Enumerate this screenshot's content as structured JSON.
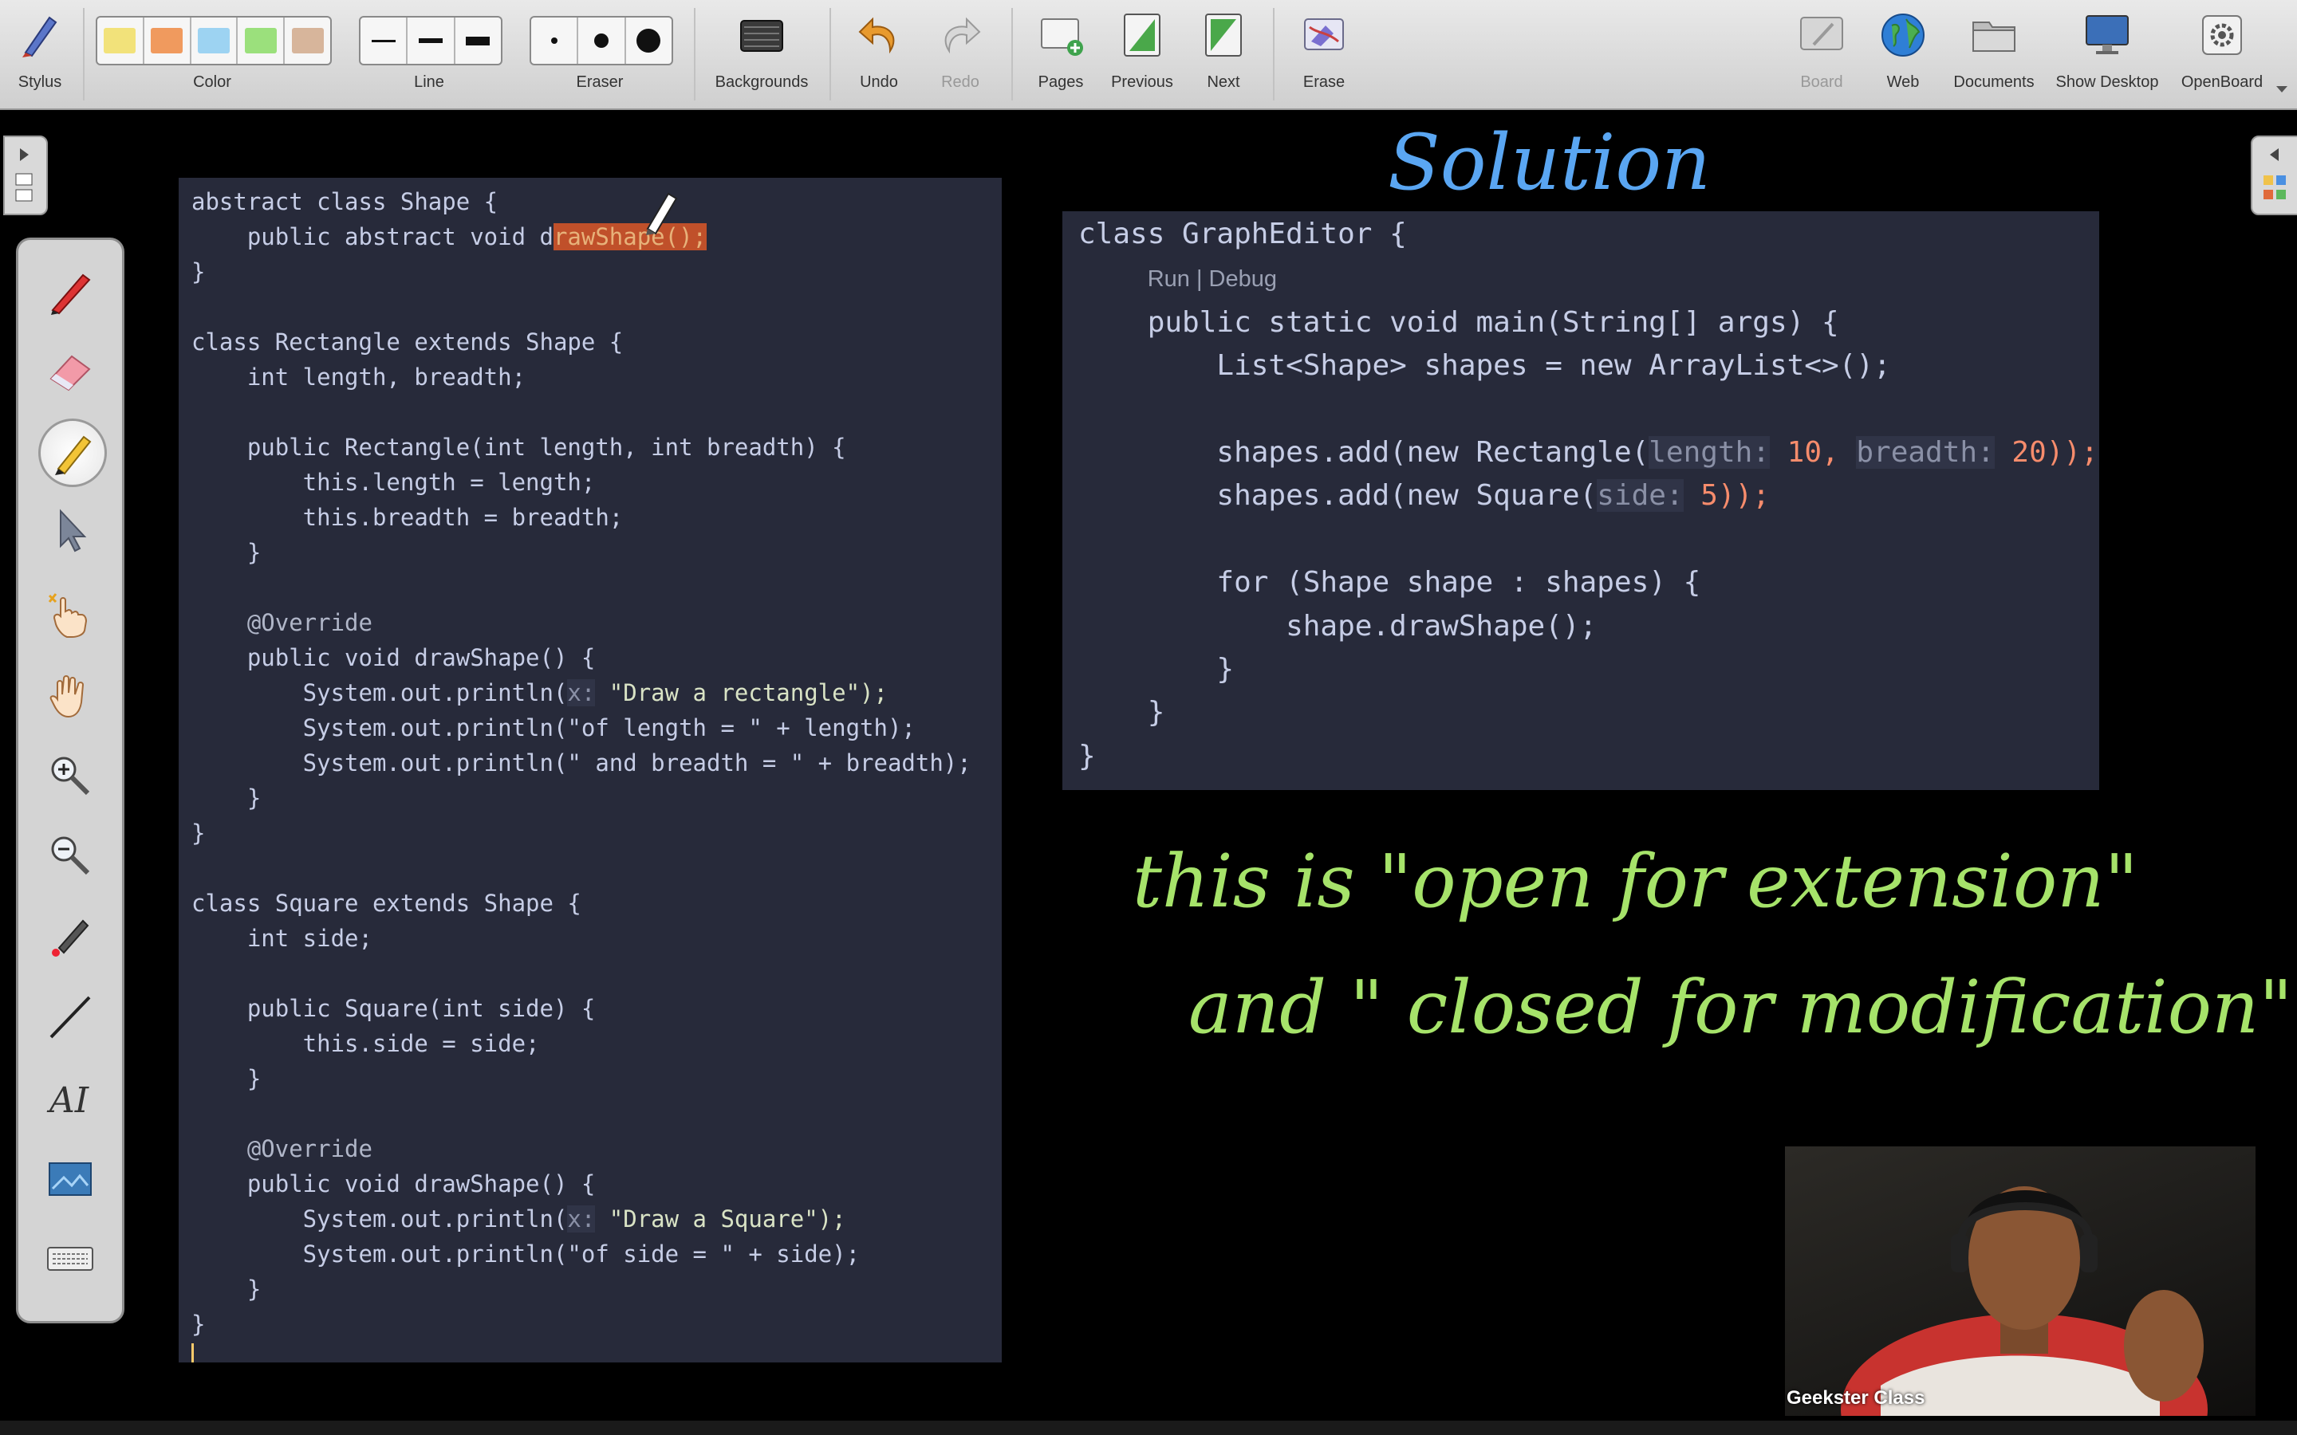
{
  "toolbar": {
    "stylus": "Stylus",
    "color": "Color",
    "line": "Line",
    "eraser": "Eraser",
    "backgrounds": "Backgrounds",
    "undo": "Undo",
    "redo": "Redo",
    "pages": "Pages",
    "previous": "Previous",
    "next": "Next",
    "erase": "Erase",
    "board": "Board",
    "web": "Web",
    "documents": "Documents",
    "show_desktop": "Show Desktop",
    "openboard": "OpenBoard"
  },
  "colors": {
    "swatches": [
      "#f2e27a",
      "#f09a5e",
      "#9dd3f2",
      "#9be07c",
      "#d7b59b"
    ],
    "code_bg": "#272a3a",
    "handwriting_green": "#a6e36a",
    "handwriting_blue": "#5aa6f2",
    "highlight": "#c0502a"
  },
  "handwriting": {
    "title": "Solution",
    "line1": "this is \"open for extension\"",
    "line2": "and \" closed for modification\""
  },
  "code_left": {
    "l01": "abstract class Shape {",
    "l02a": "    public abstract void d",
    "l02b": "rawShape();",
    "l03": "}",
    "l05": "class Rectangle extends Shape {",
    "l06": "    int length, breadth;",
    "l08": "    public Rectangle(int length, int breadth) {",
    "l09": "        this.length = length;",
    "l10": "        this.breadth = breadth;",
    "l11": "    }",
    "l13": "    @Override",
    "l14": "    public void drawShape() {",
    "l15a": "        System.out.println(",
    "l15h": "x:",
    "l15b": " \"Draw a rectangle\");",
    "l16": "        System.out.println(\"of length = \" + length);",
    "l17": "        System.out.println(\" and breadth = \" + breadth);",
    "l18": "    }",
    "l19": "}",
    "l21": "class Square extends Shape {",
    "l22": "    int side;",
    "l24": "    public Square(int side) {",
    "l25": "        this.side = side;",
    "l26": "    }",
    "l28": "    @Override",
    "l29": "    public void drawShape() {",
    "l30a": "        System.out.println(",
    "l30h": "x:",
    "l30b": " \"Draw a Square\");",
    "l31": "        System.out.println(\"of side = \" + side);",
    "l32": "    }",
    "l33": "}"
  },
  "code_right": {
    "r01": "class GraphEditor {",
    "lens": "Run | Debug",
    "r02": "    public static void main(String[] args) {",
    "r03": "        List<Shape> shapes = new ArrayList<>();",
    "r05a": "        shapes.add(new Rectangle(",
    "r05h1": "length:",
    "r05m": " 10, ",
    "r05h2": "breadth:",
    "r05b": " 20));",
    "r06a": "        shapes.add(new Square(",
    "r06h": "side:",
    "r06b": " 5));",
    "r08": "        for (Shape shape : shapes) {",
    "r09": "            shape.drawShape();",
    "r10": "        }",
    "r11": "    }",
    "r12": "}"
  },
  "webcam": {
    "name": "Geekster Class"
  }
}
